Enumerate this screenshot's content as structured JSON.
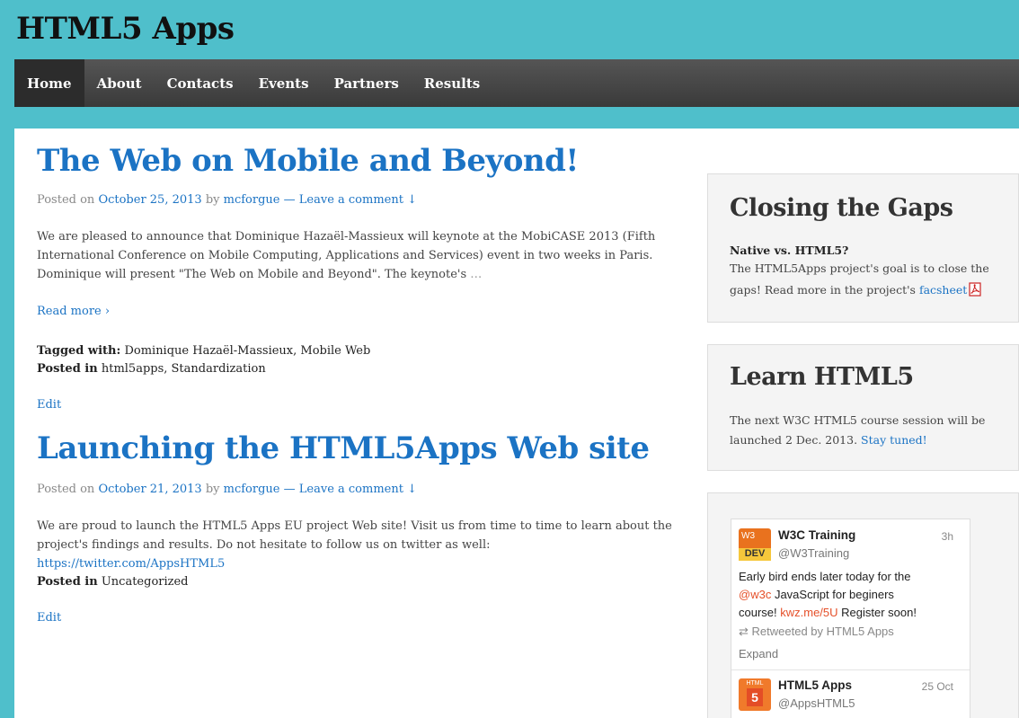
{
  "site": {
    "title": "HTML5 Apps"
  },
  "nav": {
    "items": [
      "Home",
      "About",
      "Contacts",
      "Events",
      "Partners",
      "Results"
    ]
  },
  "posts": [
    {
      "title": "The Web on Mobile and Beyond!",
      "posted_on_label": "Posted on",
      "date": "October 25, 2013",
      "by_label": "by",
      "author": "mcforgue",
      "comment_link": "— Leave a comment ↓",
      "excerpt_lines": [
        "We are pleased to announce that Dominique Hazaël-Massieux will keynote at the MobiCASE 2013 (Fifth",
        "International Conference on Mobile Computing, Applications and Services) event in two weeks in Paris.",
        "Dominique will present \"The Web on Mobile and Beyond\". The keynote's"
      ],
      "ellipsis": "…",
      "read_more": "Read more ›",
      "tagged_label": "Tagged with:",
      "tags": "Dominique Hazaël-Massieux, Mobile Web",
      "posted_in_label": "Posted in",
      "categories": "html5apps, Standardization",
      "edit": "Edit"
    },
    {
      "title": "Launching the HTML5Apps Web site",
      "posted_on_label": "Posted on",
      "date": "October 21, 2013",
      "by_label": "by",
      "author": "mcforgue",
      "comment_link": "— Leave a comment ↓",
      "excerpt_lines": [
        "We are proud to launch the HTML5 Apps EU project Web site! Visit us from time to time to learn about the",
        "project's findings and results. Do not hesitate to follow us on twitter as well:"
      ],
      "twitter_link": "https://twitter.com/AppsHTML5",
      "posted_in_label": "Posted in",
      "categories": "Uncategorized",
      "edit": "Edit"
    }
  ],
  "sidebar": {
    "gaps": {
      "title": "Closing the Gaps",
      "subtitle": "Native vs. HTML5?",
      "text_line1": "The HTML5Apps project's goal is to close the",
      "text_line2": "gaps! Read more in the project's",
      "link": "facsheet",
      "icon": "pdf-icon"
    },
    "learn": {
      "title": "Learn HTML5",
      "text_line1": "The next W3C HTML5 course session will be",
      "text_line2": "launched 2 Dec. 2013.",
      "link": "Stay tuned!"
    },
    "tweets": [
      {
        "name": "W3C Training",
        "handle": "@W3Training",
        "time": "3h",
        "body_l1": "Early bird ends later today for the",
        "mention": "@w3c",
        "body_l2": " JavaScript for beginers",
        "body_l3a": "course! ",
        "link": "kwz.me/5U",
        "body_l3b": " Register soon!",
        "retweet": "Retweeted by HTML5 Apps",
        "expand": "Expand",
        "avatar_top": "W3",
        "avatar_bottom": "DEV"
      },
      {
        "name": "HTML5 Apps",
        "handle": "@AppsHTML5",
        "time": "25 Oct",
        "avatar_top": "HTML",
        "avatar_bottom": "5"
      }
    ]
  },
  "colors": {
    "background": "#4fbfcb",
    "link": "#1b73c4",
    "nav": "#444444",
    "tweet_link": "#e5502a"
  }
}
